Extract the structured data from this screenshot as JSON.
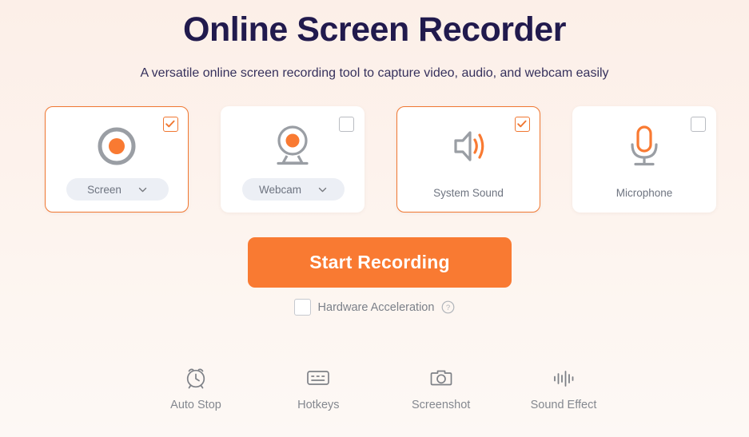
{
  "header": {
    "title": "Online Screen Recorder",
    "subtitle": "A versatile online screen recording tool to capture video, audio, and webcam easily"
  },
  "colors": {
    "accent": "#f97a32",
    "accent_border": "#f07731",
    "title": "#211a4d",
    "label_gray": "#6e7480",
    "icon_gray": "#9a9ea4",
    "pill_bg": "#eceff5",
    "page_bg_top": "#fcefe8",
    "page_bg_bottom": "#fdf8f5"
  },
  "cards": [
    {
      "id": "screen",
      "label": "Screen",
      "icon": "record-icon",
      "checked": true,
      "has_dropdown": true,
      "checkbox_name": "screen-checkbox"
    },
    {
      "id": "webcam",
      "label": "Webcam",
      "icon": "webcam-icon",
      "checked": false,
      "has_dropdown": true,
      "checkbox_name": "webcam-checkbox"
    },
    {
      "id": "system-sound",
      "label": "System Sound",
      "icon": "speaker-icon",
      "checked": true,
      "has_dropdown": false,
      "checkbox_name": "system-sound-checkbox"
    },
    {
      "id": "microphone",
      "label": "Microphone",
      "icon": "microphone-icon",
      "checked": false,
      "has_dropdown": false,
      "checkbox_name": "microphone-checkbox"
    }
  ],
  "start_button": {
    "label": "Start Recording"
  },
  "hardware_acceleration": {
    "label": "Hardware Acceleration",
    "checked": false,
    "help_icon": "question-circle-icon"
  },
  "toolbar": [
    {
      "id": "auto-stop",
      "label": "Auto Stop",
      "icon": "alarm-clock-icon"
    },
    {
      "id": "hotkeys",
      "label": "Hotkeys",
      "icon": "keyboard-icon"
    },
    {
      "id": "screenshot",
      "label": "Screenshot",
      "icon": "camera-icon"
    },
    {
      "id": "sound-effect",
      "label": "Sound Effect",
      "icon": "waveform-icon"
    }
  ]
}
